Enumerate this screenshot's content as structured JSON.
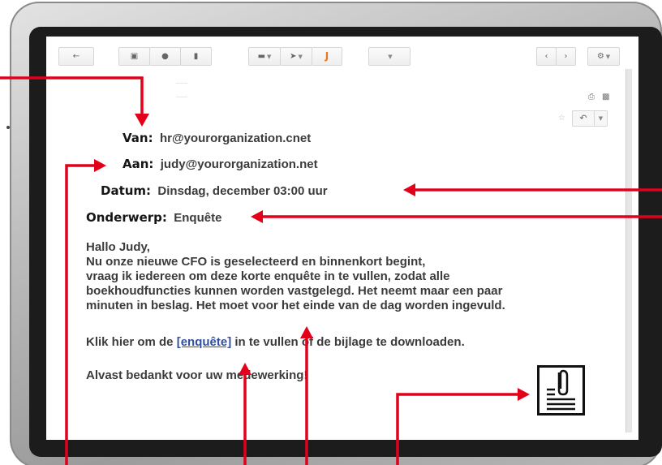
{
  "toolbar": {
    "buttons": [
      {
        "name": "back-button",
        "glyph": "←"
      },
      {
        "name": "archive-button",
        "glyph": "▣"
      },
      {
        "name": "report-spam-button",
        "glyph": "❗"
      },
      {
        "name": "delete-button",
        "glyph": "▮"
      },
      {
        "name": "move-to-button",
        "glyph": "▬"
      },
      {
        "name": "labels-button",
        "glyph": "▶"
      },
      {
        "name": "hook-button",
        "glyph": "J"
      },
      {
        "name": "more-button",
        "glyph": ""
      },
      {
        "name": "prev-button",
        "glyph": "‹"
      },
      {
        "name": "next-button",
        "glyph": "›"
      },
      {
        "name": "settings-button",
        "glyph": "⚙"
      }
    ],
    "hook_color": "#e8761e"
  },
  "email": {
    "from_label": "Van:",
    "from_value": "hr@yourorganization.cnet",
    "to_label": "Aan:",
    "to_value": "judy@yourorganization.net",
    "date_label": "Datum:",
    "date_value": "Dinsdag, december 03:00 uur",
    "subject_label": "Onderwerp:",
    "subject_value": "Enquête",
    "greeting": "Hallo Judy,",
    "body_lines": [
      "Nu onze nieuwe CFO is geselecteerd en binnenkort begint,",
      "vraag ik iedereen om deze korte enquête in te vullen, zodat alle",
      "boekhoudfuncties kunnen worden vastgelegd. Het neemt maar een paar",
      "minuten in beslag. Het moet voor het einde van de dag worden ingevuld."
    ],
    "cta_prefix": "Klik hier om de ",
    "cta_link": "[enquête]",
    "cta_suffix": " in te vullen of de bijlage te downloaden.",
    "closing": "Alvast bedankt voor uw medewerking!"
  },
  "icons": {
    "print": "printer-icon",
    "popout": "new-window-icon",
    "star": "star-icon",
    "reply": "reply-icon",
    "attachment": "attachment-document-icon"
  },
  "colors": {
    "arrow": "#e3001b",
    "link": "#2f4fa0"
  }
}
